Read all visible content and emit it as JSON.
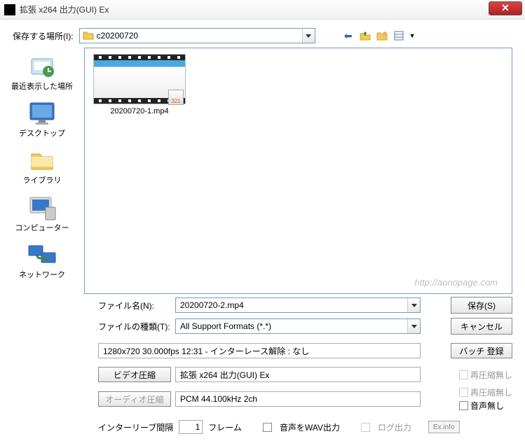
{
  "title": "拡張 x264 出力(GUI) Ex",
  "location_label": "保存する場所(I):",
  "location_value": "c20200720",
  "places": {
    "recent": "最近表示した場所",
    "desktop": "デスクトップ",
    "library": "ライブラリ",
    "computer": "コンピューター",
    "network": "ネットワーク"
  },
  "file": {
    "name": "20200720-1.mp4",
    "badge": "321"
  },
  "watermark": "http://aonopage.com",
  "filename_label": "ファイル名(N):",
  "filename_value": "20200720-2.mp4",
  "filetype_label": "ファイルの種類(T):",
  "filetype_value": "All Support Formats (*.*)",
  "save_btn": "保存(S)",
  "cancel_btn": "キャンセル",
  "info_text": "1280x720  30.000fps  12:31  -  インターレース解除 : なし",
  "batch_btn": "バッチ 登録",
  "video_btn": "ビデオ圧縮",
  "video_enc": "拡張 x264 出力(GUI) Ex",
  "audio_btn": "オーディオ圧縮",
  "audio_enc": "PCM 44.100kHz 2ch",
  "norecomp": "再圧縮無し",
  "noaudio": "音声無し",
  "interleave_label": "インターリーブ間隔",
  "interleave_val": "1",
  "frame_unit": "フレーム",
  "wav_out": "音声をWAV出力",
  "log_out": "ログ出力",
  "exinfo": "Ex.info"
}
